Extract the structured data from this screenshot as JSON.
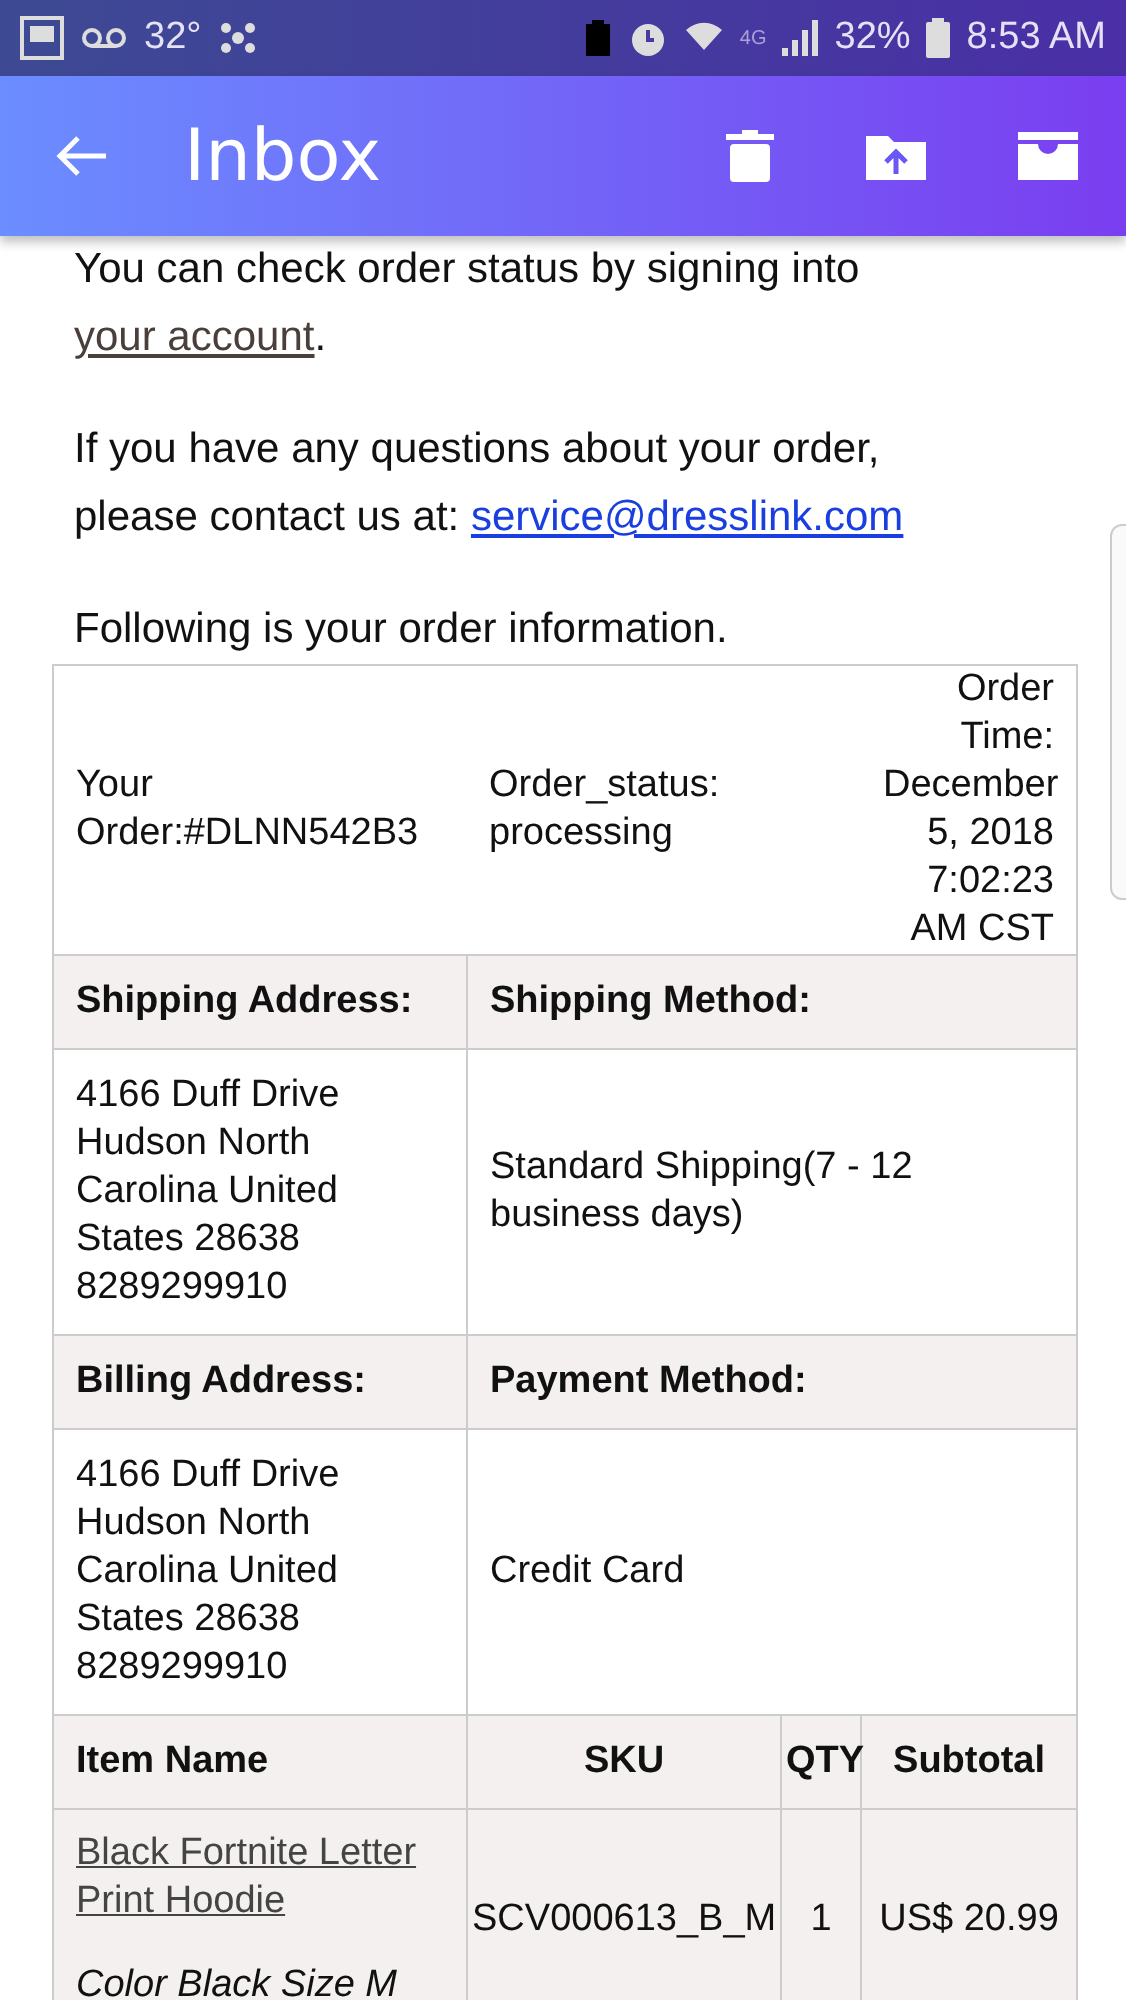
{
  "status_bar": {
    "temperature": "32°",
    "network": "4G",
    "battery": "32%",
    "time": "8:53 AM"
  },
  "header": {
    "title": "Inbox"
  },
  "paragraphs": [
    {
      "text": "You can check order status by signing into ",
      "link": "your account",
      "after": "."
    },
    {
      "text": "If you have any questions about your order, please contact us at: ",
      "link": "service@dresslink.com"
    },
    {
      "text": "Following is your order information."
    }
  ],
  "order": {
    "number": "Your Order:#DLNN542B3",
    "status": "Order_status: processing",
    "time": "Order Time: December 5, 2018 7:02:23 AM CST"
  },
  "sections": [
    {
      "headers": [
        "Shipping Address:",
        "Shipping Method:"
      ],
      "address_lines": [
        "4166 Duff Drive",
        "Hudson North",
        "Carolina United",
        "States 28638",
        "8289299910"
      ],
      "method": "Standard Shipping(7 - 12 business days)"
    },
    {
      "headers": [
        "Billing Address:",
        "Payment Method:"
      ],
      "address_lines": [
        "4166 Duff Drive",
        "Hudson North",
        "Carolina United",
        "States 28638",
        "8289299910"
      ],
      "method": "Credit Card"
    }
  ],
  "items_table": {
    "columns": [
      "Item Name",
      "SKU",
      "QTY",
      "Subtotal"
    ],
    "rows": [
      {
        "name": "Black Fortnite Letter Print Hoodie",
        "options": "Color Black Size M",
        "sku": "SCV000613_B_M",
        "qty": "1",
        "subtotal": "US$ 20.99"
      }
    ]
  }
}
